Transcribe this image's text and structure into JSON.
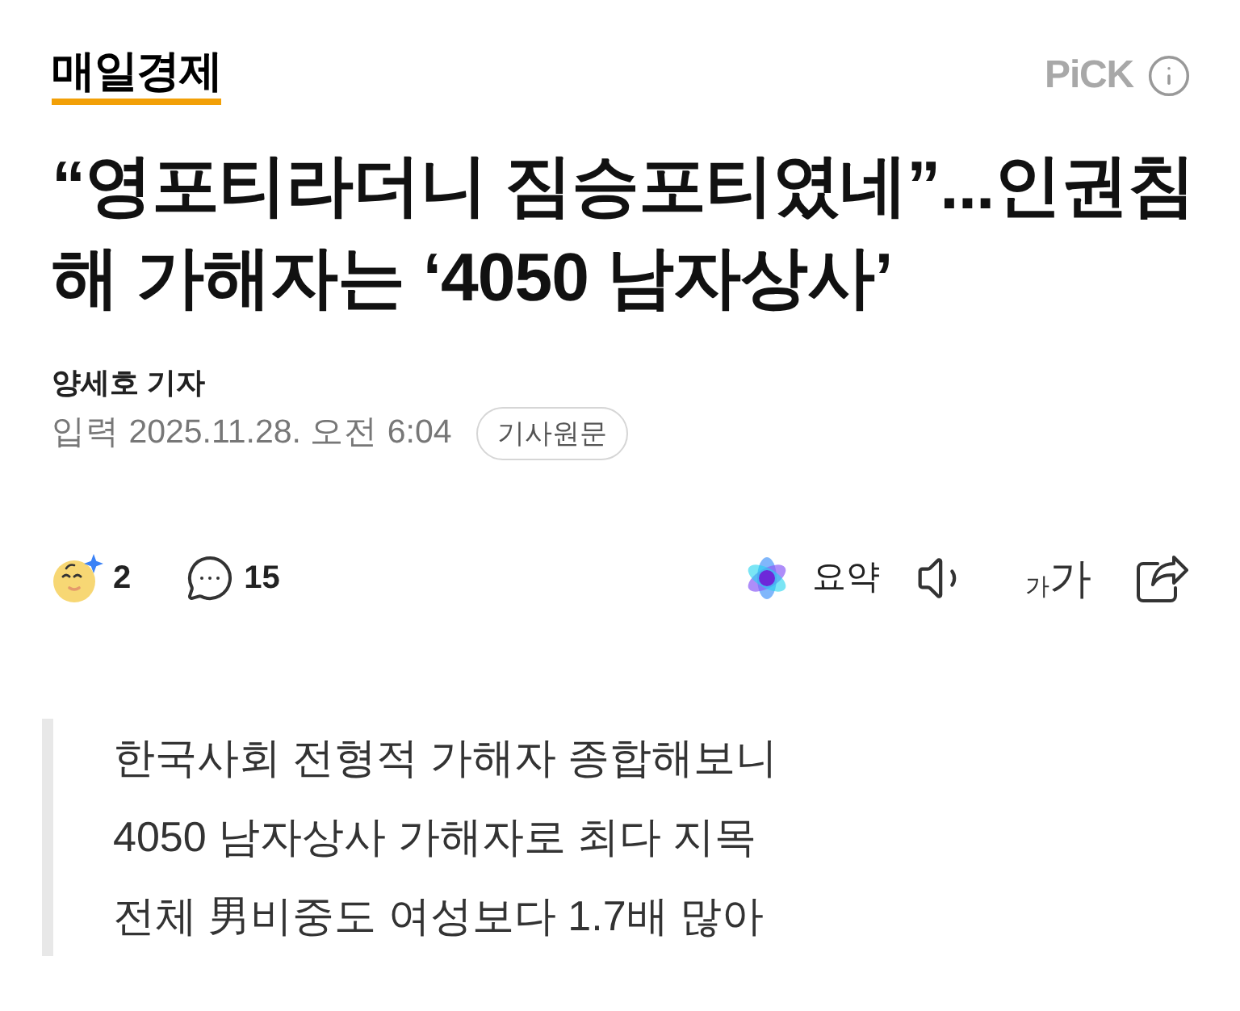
{
  "header": {
    "logo": "매일경제",
    "pick_label": "PiCK"
  },
  "headline": "“영포티라더니 짐승포티였네”...인권침해 가해자는 ‘4050 남자상사’",
  "byline": {
    "author": "양세호 기자",
    "date": "입력 2025.11.28. 오전 6:04",
    "original_button": "기사원문"
  },
  "actions": {
    "reactions": "2",
    "comments": "15",
    "summary": "요약",
    "font_size": [
      "가",
      "가"
    ]
  },
  "summary_lines": [
    "한국사회 전형적 가해자 종합해보니",
    "4050 남자상사 가해자로 최다 지목",
    "전체 男비중도 여성보다 1.7배 많아"
  ]
}
